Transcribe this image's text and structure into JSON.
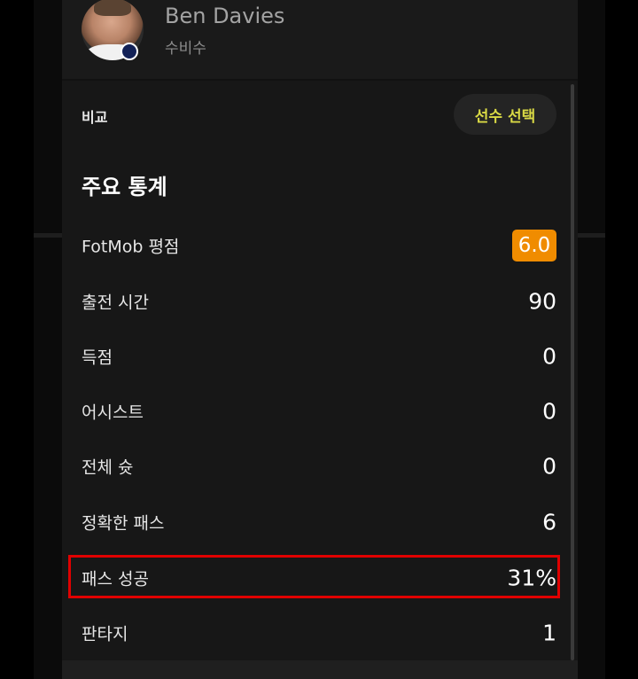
{
  "player": {
    "name": "Ben Davies",
    "position": "수비수"
  },
  "compare": {
    "label": "비교",
    "select_button": "선수 선택"
  },
  "main_stats": {
    "title": "주요 통계",
    "rows": [
      {
        "label": "FotMob 평점",
        "value": "6.0"
      },
      {
        "label": "출전 시간",
        "value": "90"
      },
      {
        "label": "득점",
        "value": "0"
      },
      {
        "label": "어시스트",
        "value": "0"
      },
      {
        "label": "전체 슛",
        "value": "0"
      },
      {
        "label": "정확한 패스",
        "value": "6"
      },
      {
        "label": "패스 성공",
        "value": "31%"
      },
      {
        "label": "판타지",
        "value": "1"
      }
    ]
  },
  "colors": {
    "accent_yellow": "#d9d945",
    "rating_orange": "#f08c00",
    "highlight_red": "#e00000"
  }
}
